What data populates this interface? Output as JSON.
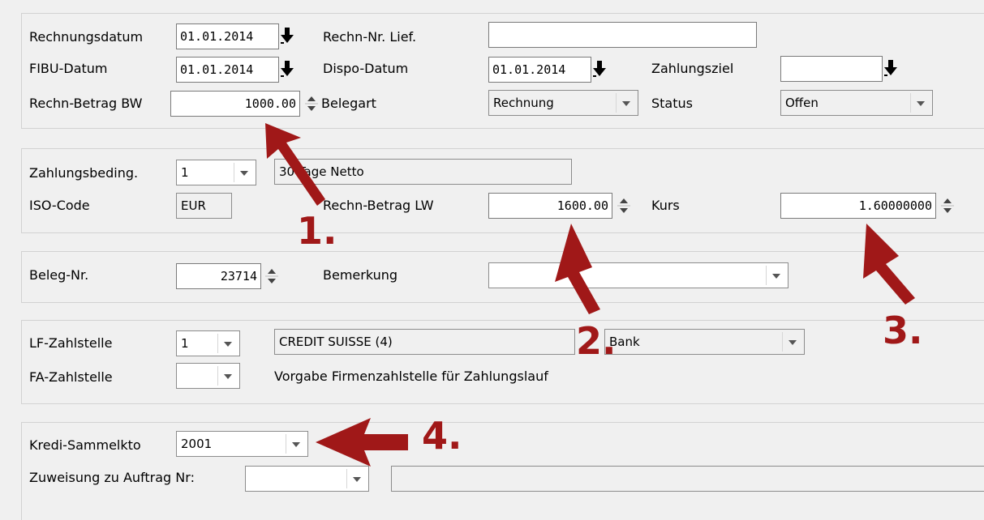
{
  "invoice": {
    "rechnungsdatum": {
      "label": "Rechnungsdatum",
      "value": "01.01.2014"
    },
    "rechn_nr_lief": {
      "label": "Rechn-Nr. Lief.",
      "value": ""
    },
    "fibu_datum": {
      "label": "FIBU-Datum",
      "value": "01.01.2014"
    },
    "dispo_datum": {
      "label": "Dispo-Datum",
      "value": "01.01.2014"
    },
    "zahlungsziel": {
      "label": "Zahlungsziel",
      "value": ""
    },
    "rechn_betrag_bw": {
      "label": "Rechn-Betrag BW",
      "value": "1000.00"
    },
    "belegart": {
      "label": "Belegart",
      "value": "Rechnung"
    },
    "status": {
      "label": "Status",
      "value": "Offen"
    }
  },
  "payment": {
    "zahlungsbeding": {
      "label": "Zahlungsbeding.",
      "value": "1",
      "text": "30 Tage Netto"
    },
    "iso_code": {
      "label": "ISO-Code",
      "value": "EUR"
    },
    "rechn_betrag_lw": {
      "label": "Rechn-Betrag LW",
      "value": "1600.00"
    },
    "kurs": {
      "label": "Kurs",
      "value": "1.60000000"
    }
  },
  "beleg": {
    "beleg_nr": {
      "label": "Beleg-Nr.",
      "value": "23714"
    },
    "bemerkung": {
      "label": "Bemerkung",
      "value": ""
    }
  },
  "zahlstelle": {
    "lf": {
      "label": "LF-Zahlstelle",
      "value": "1",
      "bank_name": "CREDIT SUISSE (4)",
      "type": "Bank"
    },
    "fa": {
      "label": "FA-Zahlstelle",
      "value": "",
      "hint": "Vorgabe Firmenzahlstelle für Zahlungslauf"
    }
  },
  "kredi": {
    "sammelkto": {
      "label": "Kredi-Sammelkto",
      "value": "2001"
    },
    "auftrag": {
      "label": "Zuweisung zu Auftrag Nr:",
      "value": "",
      "text": ""
    }
  },
  "annotations": {
    "colors": {
      "arrow": "#a01818"
    },
    "labels": [
      "1.",
      "2.",
      "3.",
      "4."
    ]
  }
}
